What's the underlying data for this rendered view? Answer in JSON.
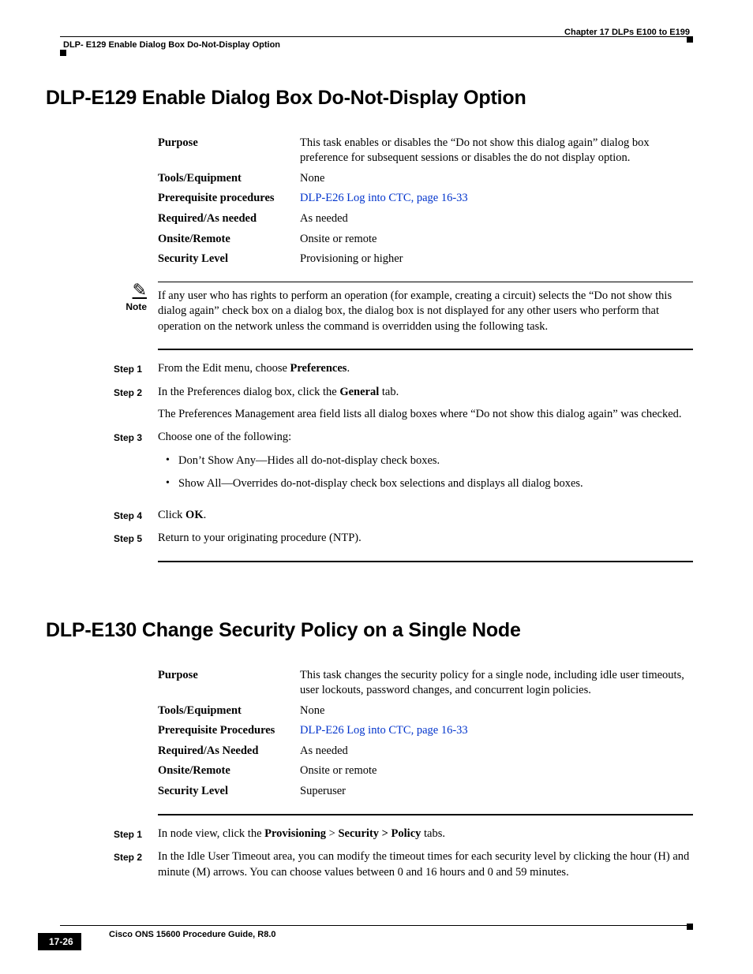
{
  "header": {
    "chapter": "Chapter 17      DLPs E100 to E199",
    "page_topic": "DLP- E129 Enable Dialog Box Do-Not-Display Option"
  },
  "sec1": {
    "title": "DLP-E129 Enable Dialog Box Do-Not-Display Option",
    "info": {
      "purpose_label": "Purpose",
      "purpose_value": "This task enables or disables the “Do not show this dialog again” dialog box preference for subsequent sessions or disables the do not display option.",
      "tools_label": "Tools/Equipment",
      "tools_value": "None",
      "prereq_label": "Prerequisite procedures",
      "prereq_link": "DLP-E26 Log into CTC, page 16-33",
      "required_label": "Required/As needed",
      "required_value": "As needed",
      "onsite_label": "Onsite/Remote",
      "onsite_value": "Onsite or remote",
      "security_label": "Security Level",
      "security_value": "Provisioning or higher"
    },
    "note": {
      "label": "Note",
      "text": "If any user who has rights to perform an operation (for example, creating a circuit) selects the “Do not show this dialog again” check box on a dialog box, the dialog box is not displayed for any other users who perform that operation on the network unless the command is overridden using the following task."
    },
    "steps": {
      "s1_label": "Step 1",
      "s1_a": "From the Edit menu, choose ",
      "s1_b": "Preferences",
      "s1_c": ".",
      "s2_label": "Step 2",
      "s2_a": "In the Preferences dialog box, click the ",
      "s2_b": "General",
      "s2_c": " tab.",
      "s2_para": "The Preferences Management area field lists all dialog boxes where “Do not show this dialog again” was checked.",
      "s3_label": "Step 3",
      "s3_text": "Choose one of the following:",
      "s3_b1": "Don’t Show Any—Hides all do-not-display check boxes.",
      "s3_b2": "Show All—Overrides do-not-display check box selections and displays all dialog boxes.",
      "s4_label": "Step 4",
      "s4_a": "Click ",
      "s4_b": "OK",
      "s4_c": ".",
      "s5_label": "Step 5",
      "s5_text": "Return to your originating procedure (NTP)."
    }
  },
  "sec2": {
    "title": "DLP-E130 Change Security Policy on a Single Node",
    "info": {
      "purpose_label": "Purpose",
      "purpose_value": "This task changes the security policy for a single node, including idle user timeouts, user lockouts, password changes, and concurrent login policies.",
      "tools_label": "Tools/Equipment",
      "tools_value": "None",
      "prereq_label": "Prerequisite Procedures",
      "prereq_link": "DLP-E26 Log into CTC, page 16-33",
      "required_label": "Required/As Needed",
      "required_value": "As needed",
      "onsite_label": "Onsite/Remote",
      "onsite_value": "Onsite or remote",
      "security_label": "Security Level",
      "security_value": "Superuser"
    },
    "steps": {
      "s1_label": "Step 1",
      "s1_a": "In node view, click the ",
      "s1_b": "Provisioning",
      "s1_c": " > ",
      "s1_d": "Security > Policy",
      "s1_e": " tabs.",
      "s2_label": "Step 2",
      "s2_text": "In the Idle User Timeout area, you can modify the timeout times for each security level by clicking the hour (H) and minute (M) arrows. You can choose values between 0 and 16 hours and 0 and 59 minutes."
    }
  },
  "footer": {
    "guide": "Cisco ONS 15600 Procedure Guide, R8.0",
    "page_num": "17-26"
  }
}
